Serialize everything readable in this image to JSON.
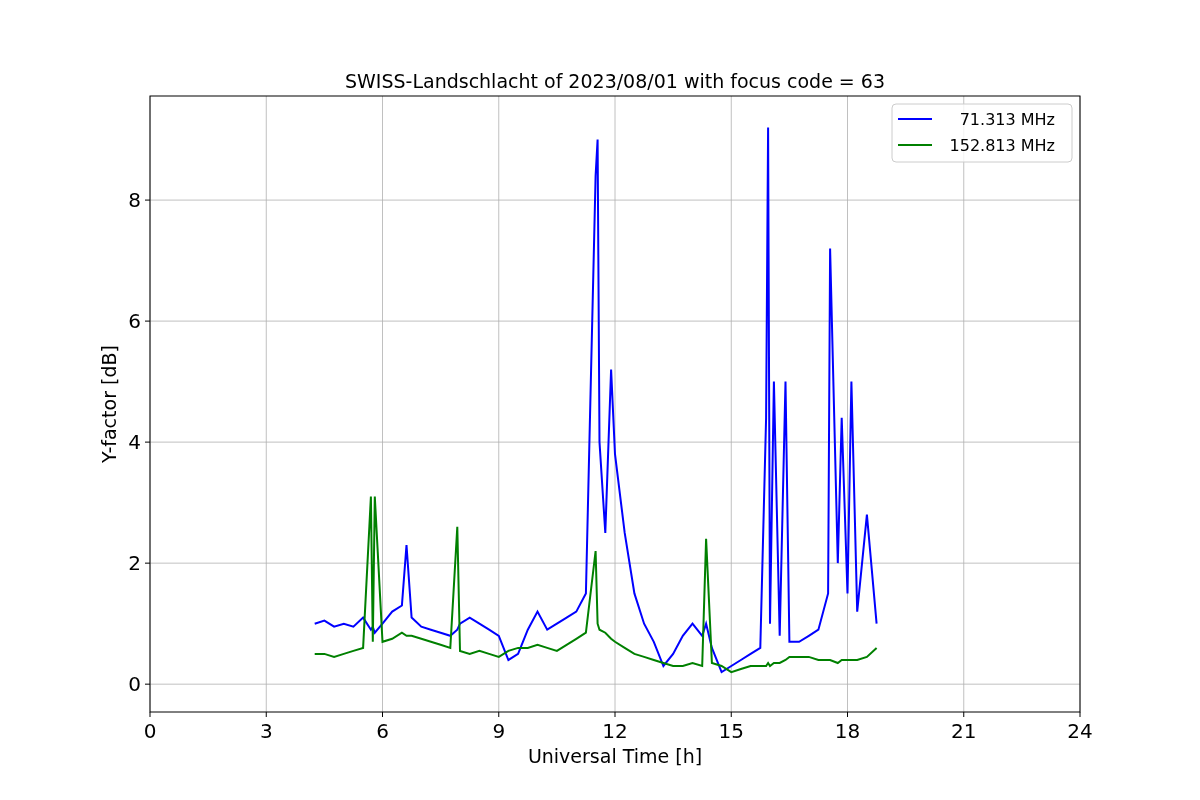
{
  "chart_data": {
    "type": "line",
    "title": "SWISS-Landschlacht of 2023/08/01 with focus code = 63",
    "xlabel": "Universal Time [h]",
    "ylabel": "Y-factor [dB]",
    "x": [
      4.25,
      4.5,
      4.75,
      5.0,
      5.25,
      5.5,
      5.7,
      5.75,
      5.8,
      6.0,
      6.25,
      6.5,
      6.62,
      6.75,
      7.0,
      7.25,
      7.5,
      7.75,
      7.93,
      8.0,
      8.25,
      8.5,
      8.75,
      9.0,
      9.25,
      9.5,
      9.75,
      10.0,
      10.25,
      10.5,
      10.75,
      11.0,
      11.25,
      11.5,
      11.55,
      11.6,
      11.75,
      11.9,
      12.0,
      12.25,
      12.5,
      12.75,
      13.0,
      13.25,
      13.5,
      13.75,
      14.0,
      14.25,
      14.35,
      14.5,
      14.75,
      15.0,
      15.25,
      15.5,
      15.75,
      15.9,
      15.95,
      16.0,
      16.1,
      16.25,
      16.4,
      16.5,
      16.75,
      17.0,
      17.25,
      17.5,
      17.55,
      17.75,
      17.85,
      18.0,
      18.1,
      18.25,
      18.5,
      18.75
    ],
    "series": [
      {
        "name": "71.313 MHz",
        "color": "#0000ff",
        "values": [
          1.0,
          1.05,
          0.95,
          1.0,
          0.95,
          1.1,
          0.9,
          0.95,
          0.85,
          1.0,
          1.2,
          1.3,
          2.3,
          1.1,
          0.95,
          0.9,
          0.85,
          0.8,
          0.9,
          1.0,
          1.1,
          1.0,
          0.9,
          0.8,
          0.4,
          0.5,
          0.9,
          1.2,
          0.9,
          1.0,
          1.1,
          1.2,
          1.5,
          8.4,
          9.0,
          4.0,
          2.5,
          5.2,
          3.8,
          2.5,
          1.5,
          1.0,
          0.7,
          0.3,
          0.5,
          0.8,
          1.0,
          0.8,
          1.0,
          0.6,
          0.2,
          0.3,
          0.4,
          0.5,
          0.6,
          4.4,
          9.2,
          1.0,
          5.0,
          0.8,
          5.0,
          0.7,
          0.7,
          0.8,
          0.9,
          1.5,
          7.2,
          2.0,
          4.4,
          1.5,
          5.0,
          1.2,
          2.8,
          1.0
        ]
      },
      {
        "name": "152.813 MHz",
        "color": "#008000",
        "values": [
          0.5,
          0.5,
          0.45,
          0.5,
          0.55,
          0.6,
          3.1,
          0.7,
          3.1,
          0.7,
          0.75,
          0.85,
          0.8,
          0.8,
          0.75,
          0.7,
          0.65,
          0.6,
          2.6,
          0.55,
          0.5,
          0.55,
          0.5,
          0.45,
          0.55,
          0.6,
          0.6,
          0.65,
          0.6,
          0.55,
          0.65,
          0.75,
          0.85,
          2.2,
          1.0,
          0.9,
          0.85,
          0.75,
          0.7,
          0.6,
          0.5,
          0.45,
          0.4,
          0.35,
          0.3,
          0.3,
          0.35,
          0.3,
          2.4,
          0.35,
          0.3,
          0.2,
          0.25,
          0.3,
          0.3,
          0.3,
          0.35,
          0.3,
          0.35,
          0.35,
          0.4,
          0.45,
          0.45,
          0.45,
          0.4,
          0.4,
          0.4,
          0.35,
          0.4,
          0.4,
          0.4,
          0.4,
          0.45,
          0.6
        ]
      }
    ],
    "xlim": [
      0,
      24
    ],
    "ylim": [
      -0.46,
      9.72
    ],
    "xticks": [
      0,
      3,
      6,
      9,
      12,
      15,
      18,
      21,
      24
    ],
    "yticks": [
      0,
      2,
      4,
      6,
      8
    ],
    "grid": true,
    "legend": true
  }
}
